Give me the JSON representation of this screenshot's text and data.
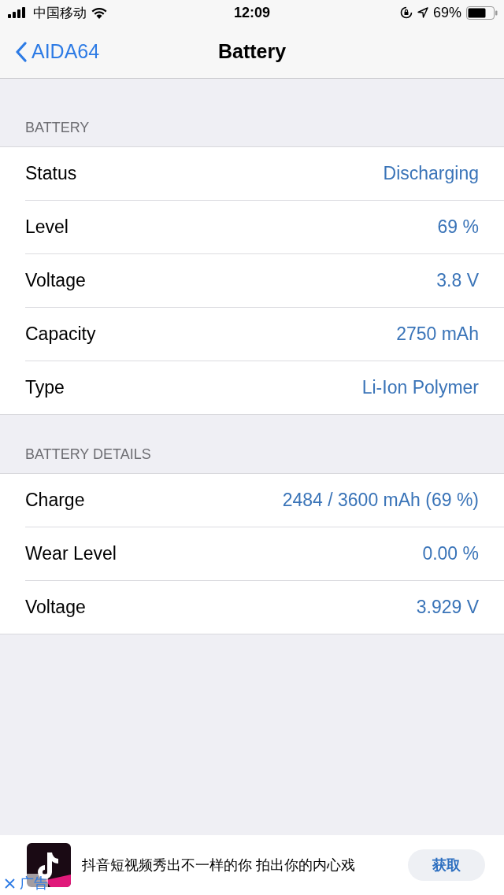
{
  "status_bar": {
    "carrier": "中国移动",
    "time": "12:09",
    "battery_percent": "69%"
  },
  "nav": {
    "back": "AIDA64",
    "title": "Battery"
  },
  "sections": [
    {
      "header": "BATTERY",
      "rows": [
        {
          "label": "Status",
          "value": "Discharging"
        },
        {
          "label": "Level",
          "value": "69 %"
        },
        {
          "label": "Voltage",
          "value": "3.8 V"
        },
        {
          "label": "Capacity",
          "value": "2750 mAh"
        },
        {
          "label": "Type",
          "value": "Li-Ion Polymer"
        }
      ]
    },
    {
      "header": "BATTERY DETAILS",
      "rows": [
        {
          "label": "Charge",
          "value": "2484 / 3600 mAh (69 %)"
        },
        {
          "label": "Wear Level",
          "value": "0.00 %"
        },
        {
          "label": "Voltage",
          "value": "3.929 V"
        }
      ]
    }
  ],
  "ad": {
    "text": "抖音短视频秀出不一样的你 拍出你的内心戏",
    "button": "获取",
    "ad_label": "广告"
  }
}
